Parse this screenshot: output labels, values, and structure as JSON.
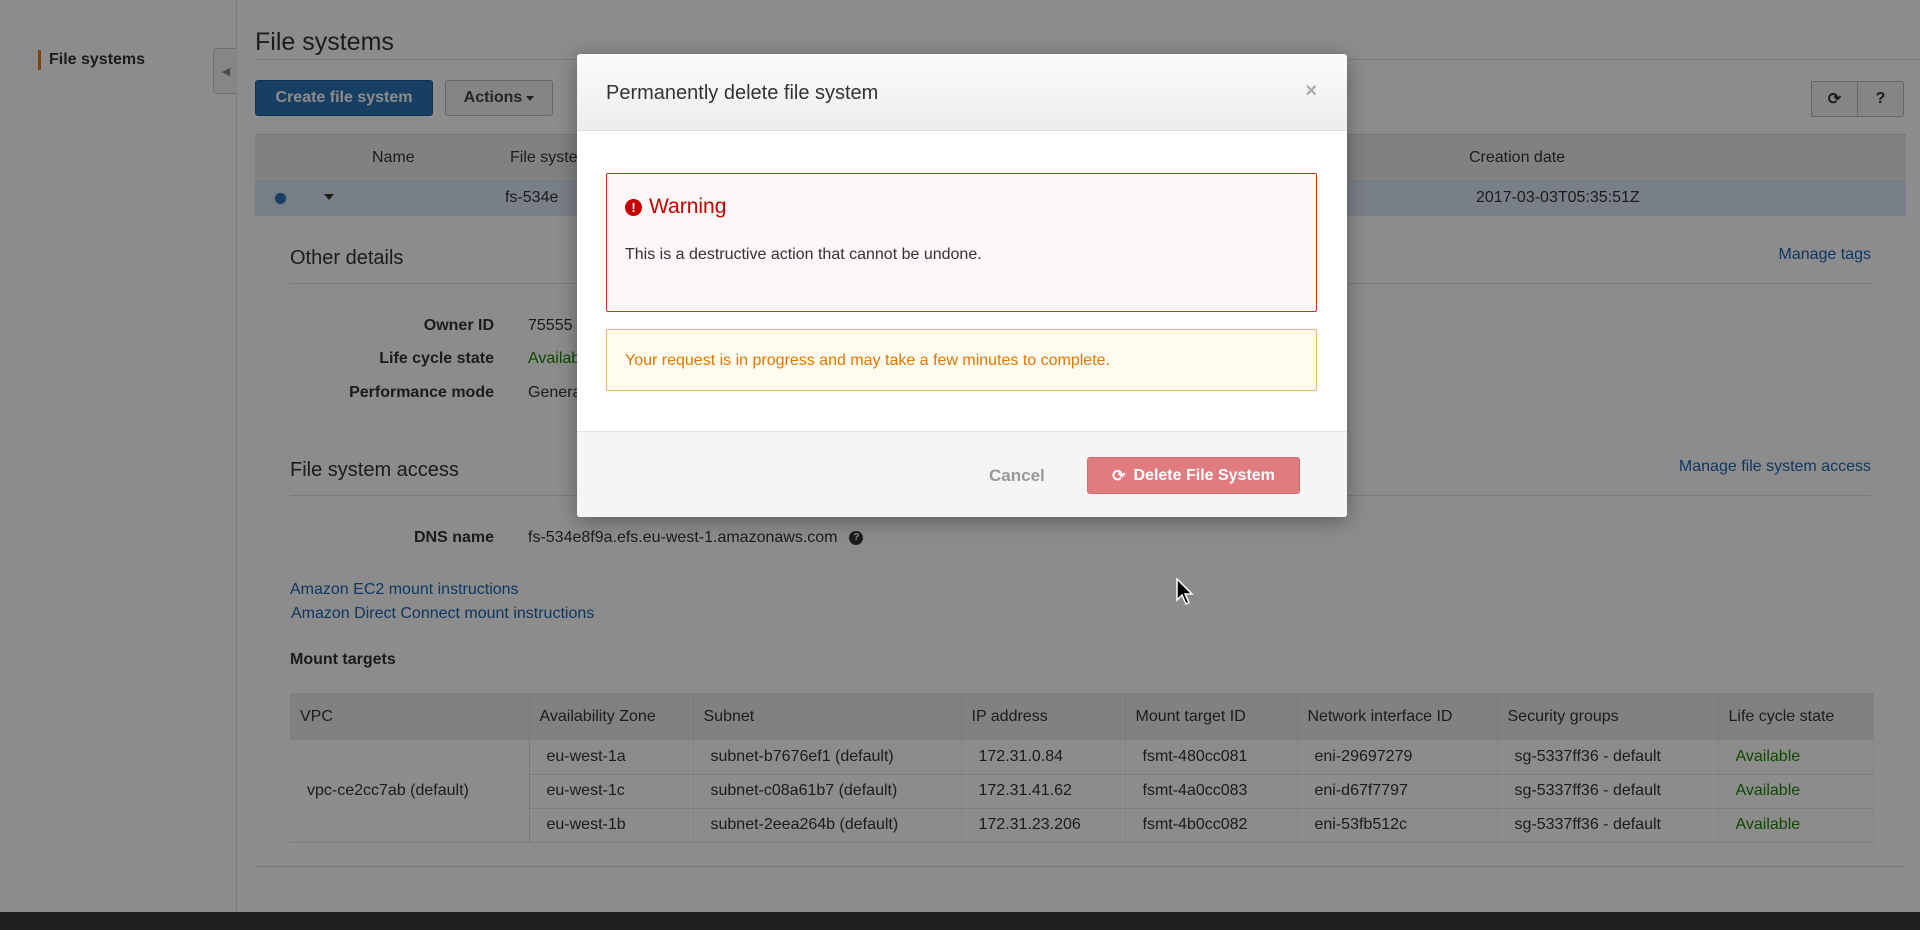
{
  "sidebar": {
    "active_item": "File systems"
  },
  "page": {
    "title": "File systems",
    "create_button": "Create file system",
    "actions_button": "Actions",
    "refresh_icon": "refresh-icon",
    "help_icon": "help-icon"
  },
  "list": {
    "columns": [
      "Name",
      "File syste",
      "Creation date"
    ],
    "row": {
      "file_system_id": "fs-534e",
      "creation_date": "2017-03-03T05:35:51Z"
    }
  },
  "other_details": {
    "title": "Other details",
    "manage_tags": "Manage tags",
    "owner_id_label": "Owner ID",
    "owner_id_value": "75555",
    "lifecycle_label": "Life cycle state",
    "lifecycle_value": "Availab",
    "perf_label": "Performance mode",
    "perf_value": "Genera"
  },
  "access": {
    "title": "File system access",
    "manage_access": "Manage file system access",
    "dns_label": "DNS name",
    "dns_value": "fs-534e8f9a.efs.eu-west-1.amazonaws.com",
    "ec2_link": "Amazon EC2 mount instructions",
    "dc_link": "Amazon Direct Connect mount instructions"
  },
  "mount_targets": {
    "title": "Mount targets",
    "columns": [
      "VPC",
      "Availability Zone",
      "Subnet",
      "IP address",
      "Mount target ID",
      "Network interface ID",
      "Security groups",
      "Life cycle state"
    ],
    "vpc": "vpc-ce2cc7ab (default)",
    "rows": [
      {
        "az": "eu-west-1a",
        "subnet": "subnet-b7676ef1 (default)",
        "ip": "172.31.0.84",
        "mt_id": "fsmt-480cc081",
        "eni": "eni-29697279",
        "sg": "sg-5337ff36 - default",
        "state": "Available"
      },
      {
        "az": "eu-west-1c",
        "subnet": "subnet-c08a61b7 (default)",
        "ip": "172.31.41.62",
        "mt_id": "fsmt-4a0cc083",
        "eni": "eni-d67f7797",
        "sg": "sg-5337ff36 - default",
        "state": "Available"
      },
      {
        "az": "eu-west-1b",
        "subnet": "subnet-2eea264b (default)",
        "ip": "172.31.23.206",
        "mt_id": "fsmt-4b0cc082",
        "eni": "eni-53fb512c",
        "sg": "sg-5337ff36 - default",
        "state": "Available"
      }
    ]
  },
  "modal": {
    "title": "Permanently delete file system",
    "close": "×",
    "warning_title": "Warning",
    "warning_text": "This is a destructive action that cannot be undone.",
    "progress_text": "Your request is in progress and may take a few minutes to complete.",
    "cancel": "Cancel",
    "delete": "Delete File System"
  },
  "colors": {
    "primary": "#2b74b6",
    "danger": "#c40000",
    "warning": "#e07700",
    "success": "#1d8102",
    "link": "#1b65b2"
  }
}
